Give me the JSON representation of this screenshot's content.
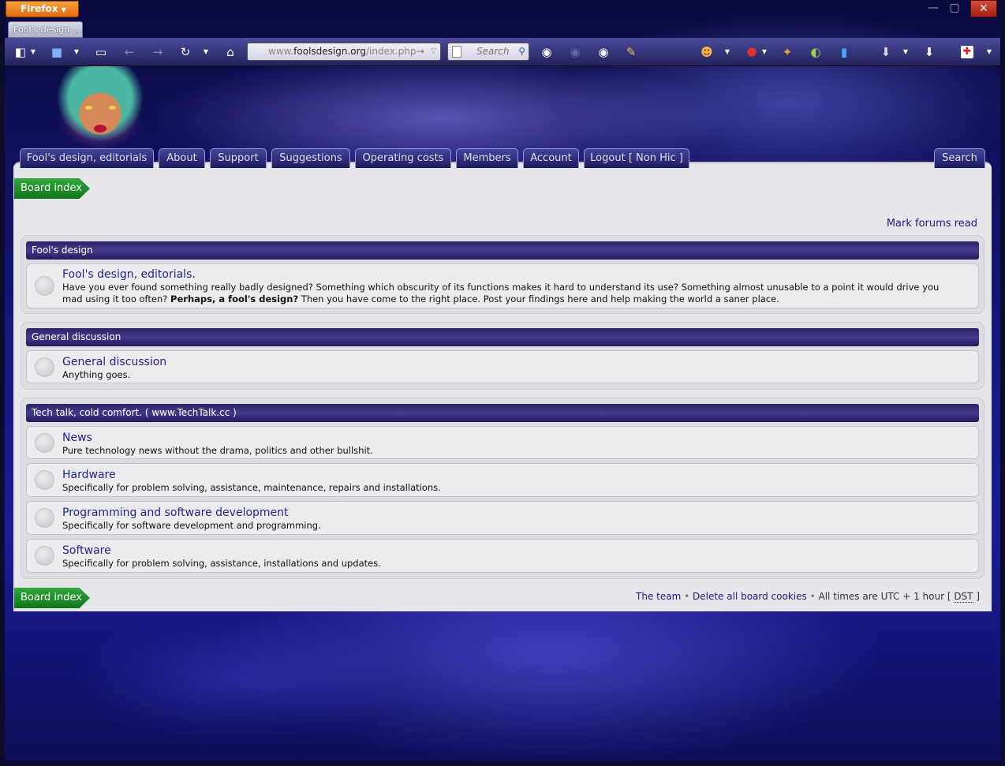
{
  "browser": {
    "menu_button": "Firefox",
    "tab_title": "Fool's design ...",
    "url_host_prefix": "www.",
    "url_domain": "foolsdesign.org",
    "url_path": "/index.php",
    "search_placeholder": "Search",
    "window_controls": {
      "minimize": "—",
      "maximize": "▢",
      "close": "✕"
    }
  },
  "nav": {
    "items": [
      "Fool's design, editorials",
      "About",
      "Support",
      "Suggestions",
      "Operating costs",
      "Members",
      "Account",
      "Logout [ Non Hic ]"
    ],
    "search": "Search"
  },
  "breadcrumb": "Board index",
  "mark_forums_read": "Mark forums read",
  "categories": [
    {
      "title": "Fool's design",
      "forums": [
        {
          "name": "Fool's design, editorials.",
          "desc_1": "Have you ever found something really badly designed? Something which obscurity of its functions makes it hard to understand its use? Something almost unusable to a point it would drive you mad using it too often? ",
          "desc_bold": "Perhaps, a fool's design?",
          "desc_2": " Then you have come to the right place. Post your findings here and help making the world a saner place."
        }
      ]
    },
    {
      "title": "General discussion",
      "forums": [
        {
          "name": "General discussion",
          "desc": "Anything goes."
        }
      ]
    },
    {
      "title": "Tech talk, cold comfort. ( www.TechTalk.cc )",
      "forums": [
        {
          "name": "News",
          "desc": "Pure technology news without the drama, politics and other bullshit."
        },
        {
          "name": "Hardware",
          "desc": "Specifically for problem solving, assistance, maintenance, repairs and installations."
        },
        {
          "name": "Programming and software development",
          "desc": "Specifically for software development and programming."
        },
        {
          "name": "Software",
          "desc": "Specifically for problem solving, assistance, installations and updates."
        }
      ]
    }
  ],
  "footer": {
    "team": "The team",
    "delete_cookies": "Delete all board cookies",
    "bullet": "•",
    "times_prefix": "All times are UTC + 1 hour [ ",
    "dst": "DST",
    "times_suffix": " ]"
  },
  "colors": {
    "accent": "#1b1b88",
    "crumb_green": "#2fa83a",
    "firefox_orange": "#e36a0d"
  }
}
